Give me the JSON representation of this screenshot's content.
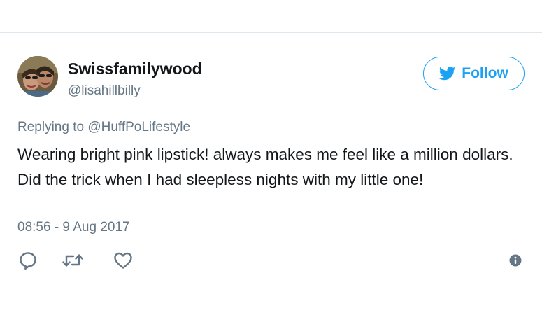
{
  "tweet": {
    "display_name": "Swissfamilywood",
    "handle": "@lisahillbilly",
    "follow_label": "Follow",
    "reply_context": "Replying to @HuffPoLifestyle",
    "text": "Wearing bright pink lipstick! always makes me feel like a million dollars. Did the trick when I had sleepless nights with my little one!",
    "timestamp": "08:56 - 9 Aug 2017"
  },
  "icons": {
    "follow": "twitter-bird-icon",
    "reply": "reply-icon",
    "retweet": "retweet-icon",
    "like": "heart-icon",
    "info": "info-icon"
  },
  "colors": {
    "accent": "#1da1f2",
    "text_primary": "#14171a",
    "text_secondary": "#657786",
    "border": "#e1e8ed"
  }
}
